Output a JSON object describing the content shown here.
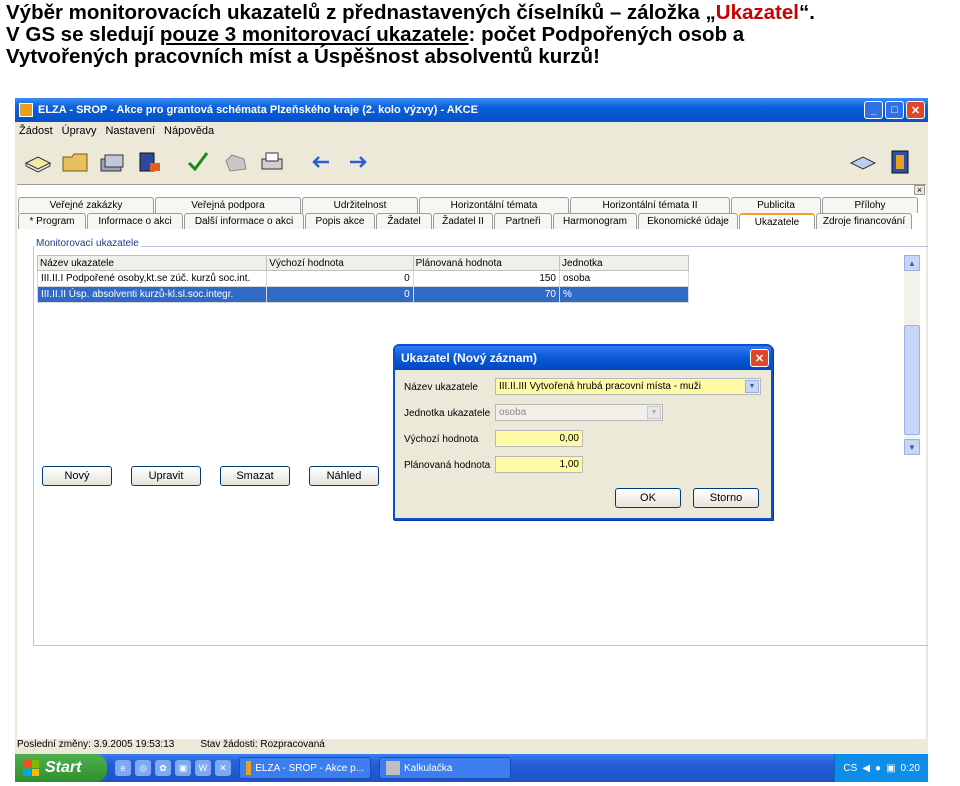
{
  "slide": {
    "line1_prefix": "Výběr monitorovacích ukazatelů z přednastavených číselníků – záložka „",
    "line1_accent": "Ukazatel",
    "line1_suffix": "“.",
    "line2_prefix": "V GS se sledují ",
    "line2_underlined": "pouze 3 monitorovací ukazatele",
    "line2_suffix": ": počet Podpořených osob a",
    "line3": "Vytvořených pracovních míst a Úspěšnost absolventů kurzů!"
  },
  "window": {
    "title": "ELZA - SROP - Akce pro grantová schémata Plzeňského kraje (2. kolo výzvy) - AKCE",
    "minimize": "_",
    "maximize": "□",
    "close": "✕"
  },
  "menu": [
    "Žádost",
    "Úpravy",
    "Nastavení",
    "Nápověda"
  ],
  "toolbar_icons": [
    "open-book-icon",
    "folder-icon",
    "disk-stack-icon",
    "printer-icon",
    "checkmark-icon",
    "hand-icon",
    "print-icon",
    "arrow-left-icon",
    "arrow-right-icon",
    "help-book-icon",
    "exit-door-icon"
  ],
  "tabs_top": [
    "Veřejné zakázky",
    "Veřejná podpora",
    "Udržitelnost",
    "Horizontální témata",
    "Horizontální témata II",
    "Publicita",
    "Přílohy"
  ],
  "tabs_bottom": [
    "* Program",
    "Informace o akci",
    "Další informace o akci",
    "Popis akce",
    "Žadatel",
    "Žadatel II",
    "Partneři",
    "Harmonogram",
    "Ekonomické údaje",
    "Ukazatele",
    "Zdroje financování"
  ],
  "active_tab": "Ukazatele",
  "group_title": "Monitorovací ukazatele",
  "grid": {
    "columns": [
      "Název ukazatele",
      "Výchozí hodnota",
      "Plánovaná hodnota",
      "Jednotka"
    ],
    "rows": [
      {
        "name": "III.II.I Podpořené osoby,kt.se zúč. kurzů soc.int.",
        "start": "0",
        "planned": "150",
        "unit": "osoba",
        "selected": false
      },
      {
        "name": "III.II.II Úsp. absolventi kurzů-kl.sl.soc.integr.",
        "start": "0",
        "planned": "70",
        "unit": "%",
        "selected": true
      }
    ]
  },
  "buttons": {
    "new": "Nový",
    "edit": "Upravit",
    "delete": "Smazat",
    "preview": "Náhled"
  },
  "dialog": {
    "title": "Ukazatel (Nový záznam)",
    "name_label": "Název ukazatele",
    "name_value": "III.II.III Vytvořená hrubá pracovní místa - muži",
    "unit_label": "Jednotka ukazatele",
    "unit_value": "osoba",
    "start_label": "Výchozí hodnota",
    "start_value": "0,00",
    "planned_label": "Plánovaná hodnota",
    "planned_value": "1,00",
    "ok": "OK",
    "cancel": "Storno"
  },
  "status": {
    "last_change": "Poslední změny: 3.9.2005 19:53:13",
    "state": "Stav žádosti: Rozpracovaná"
  },
  "taskbar": {
    "start": "Start",
    "quicklaunch": [
      "e",
      "◎",
      "✿",
      "▣",
      "W",
      "✕"
    ],
    "items": [
      "ELZA - SROP - Akce p...",
      "Kalkulačka"
    ],
    "lang": "CS",
    "time": "0:20"
  },
  "colors": {
    "accent": "#cc0000",
    "selection": "#316ac5",
    "titlebar": "#0a5fd8",
    "required_field": "#fffaa6"
  }
}
